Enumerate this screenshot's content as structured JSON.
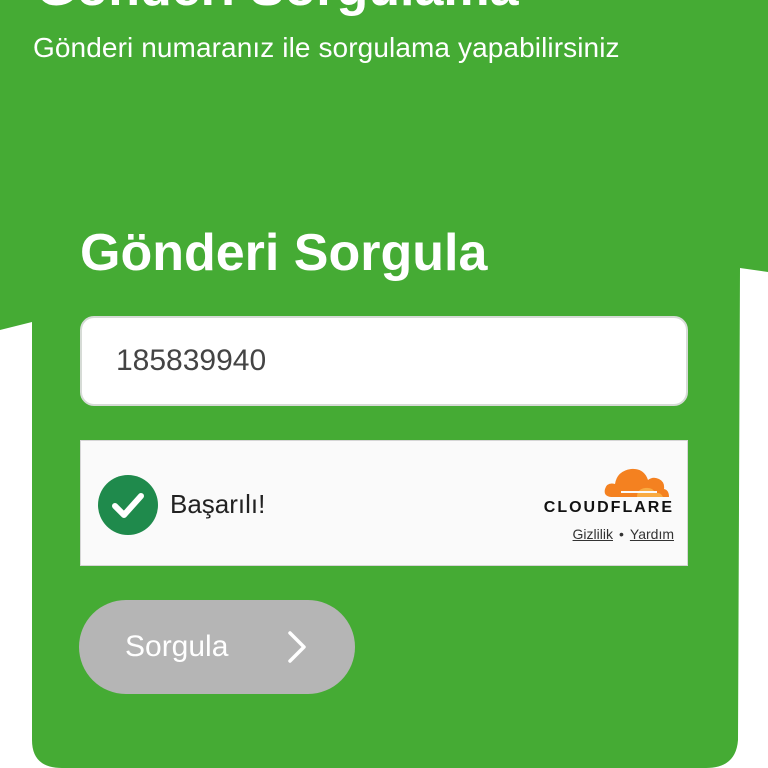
{
  "hero": {
    "title": "Gönderi Sorgulama",
    "subtitle": "Gönderi numaranız ile sorgulama yapabilirsiniz"
  },
  "form": {
    "title": "Gönderi Sorgula",
    "tracking_number": "185839940",
    "submit_label": "Sorgula"
  },
  "captcha": {
    "status": "Başarılı!",
    "brand": "CLOUDFLARE",
    "privacy_link": "Gizlilik",
    "separator": "•",
    "help_link": "Yardım"
  },
  "colors": {
    "brand_green": "#45ab34",
    "success_green": "#1f8a4c",
    "cloudflare_orange": "#f48120",
    "button_disabled": "#b5b5b5"
  },
  "icons": {
    "captcha_check": "check-circle-icon",
    "brand_logo": "cloudflare-cloud-icon",
    "submit_arrow": "chevron-right-icon"
  }
}
